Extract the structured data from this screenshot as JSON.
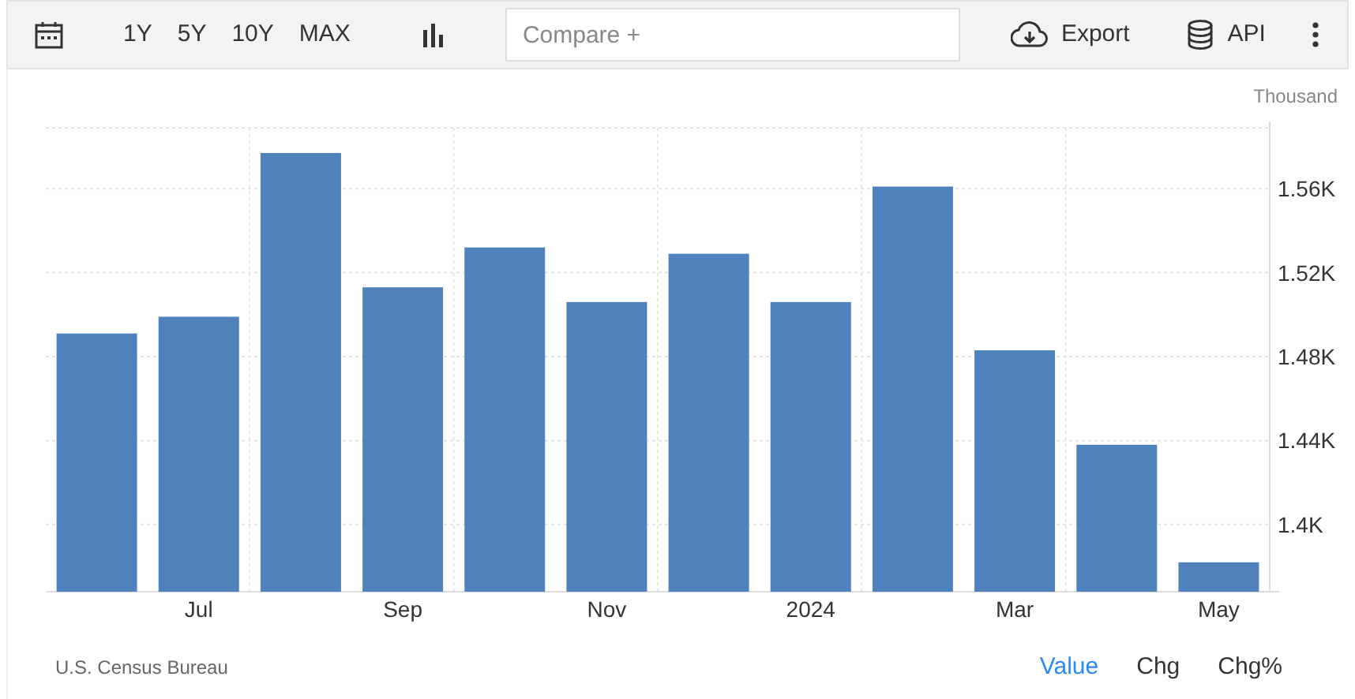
{
  "toolbar": {
    "ranges": [
      {
        "label": "1Y",
        "selected": false
      },
      {
        "label": "5Y",
        "selected": false
      },
      {
        "label": "10Y",
        "selected": false
      },
      {
        "label": "MAX",
        "selected": false
      }
    ],
    "compare": {
      "placeholder": "Compare +"
    },
    "export": "Export",
    "api": "API"
  },
  "chart": {
    "unit": "Thousand",
    "chart_data": {
      "type": "bar",
      "grid": true,
      "categories": [
        null,
        "Jul",
        null,
        "Sep",
        null,
        "Nov",
        null,
        "2024",
        null,
        "Mar",
        null,
        "May"
      ],
      "series": [
        {
          "color": "#4f81bd",
          "values": [
            1.491,
            1.499,
            1.577,
            1.513,
            1.532,
            1.506,
            1.529,
            1.506,
            1.561,
            1.483,
            1.438,
            1.382
          ]
        }
      ],
      "ylim": [
        1.368,
        1.589
      ],
      "yticks": [
        {
          "value": 1.4,
          "label": "1.4K"
        },
        {
          "value": 1.44,
          "label": "1.44K"
        },
        {
          "value": 1.48,
          "label": "1.48K"
        },
        {
          "value": 1.52,
          "label": "1.52K"
        },
        {
          "value": 1.56,
          "label": "1.56K"
        }
      ]
    }
  },
  "footer": {
    "source": "U.S. Census Bureau",
    "views": [
      {
        "label": "Value",
        "selected": true
      },
      {
        "label": "Chg",
        "selected": false
      },
      {
        "label": "Chg%",
        "selected": false
      }
    ]
  }
}
